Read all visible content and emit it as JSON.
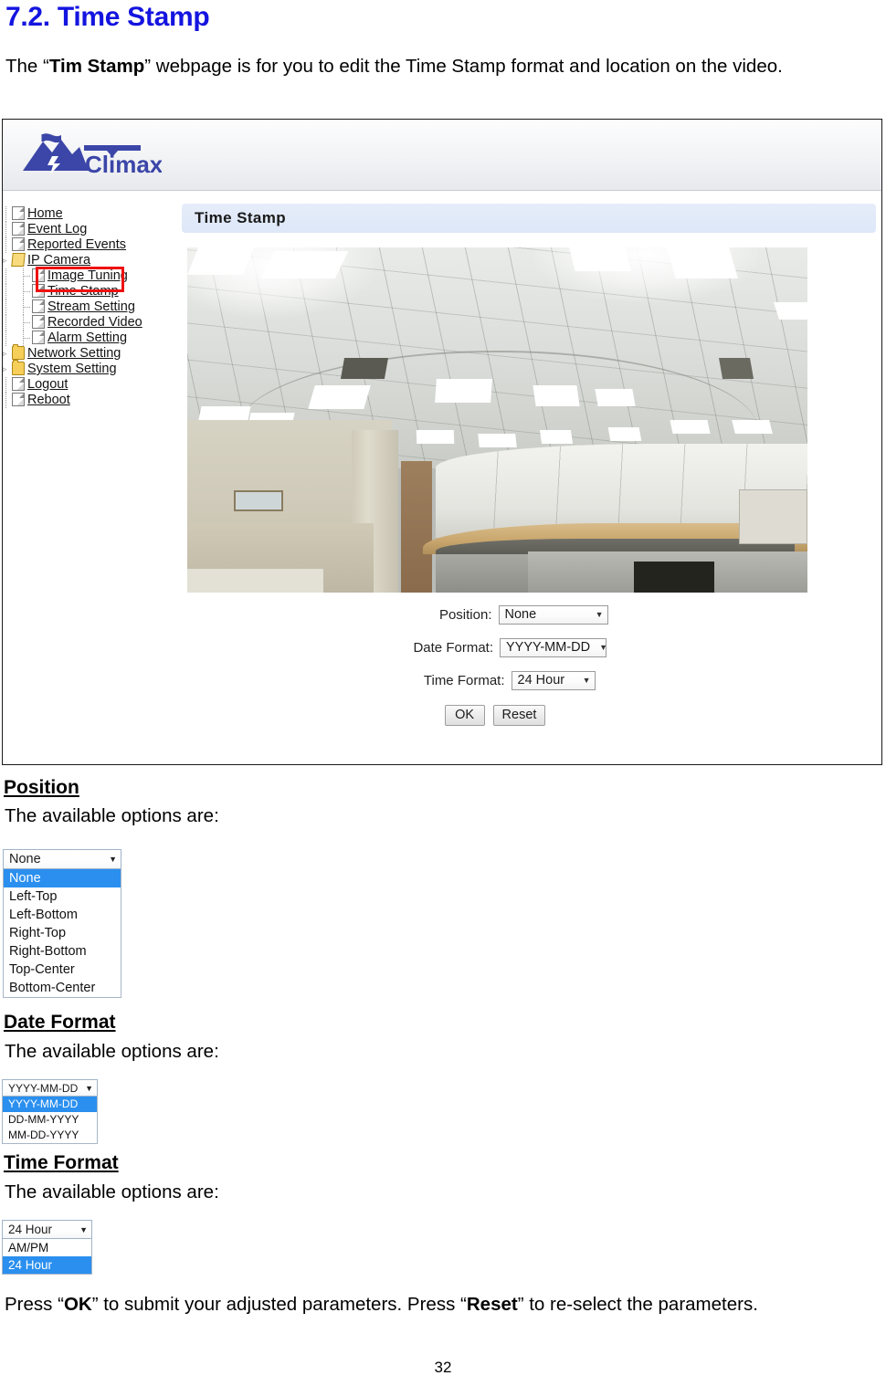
{
  "document": {
    "heading": "7.2. Time Stamp",
    "intro_prefix": "The “",
    "intro_bold": "Tim Stamp",
    "intro_suffix": "” webpage is for you to edit the Time Stamp format and location on the video.",
    "page_number": "32",
    "press_prefix": "Press “",
    "press_ok": "OK",
    "press_mid": "” to submit your adjusted parameters. Press “",
    "press_reset": "Reset",
    "press_suffix": "” to re-select the parameters."
  },
  "sections": [
    {
      "heading": "Position",
      "subtext": "The available options are:"
    },
    {
      "heading": "Date Format",
      "subtext": "The available options are:"
    },
    {
      "heading": "Time Format",
      "subtext": "The available options are:"
    }
  ],
  "webui": {
    "brand": "Climax",
    "panel_title": "Time Stamp",
    "sidebar": [
      {
        "label": "Home",
        "icon": "page-icon",
        "level": 0,
        "expander": ""
      },
      {
        "label": "Event Log",
        "icon": "page-icon",
        "level": 0,
        "expander": ""
      },
      {
        "label": "Reported Events",
        "icon": "page-icon",
        "level": 0,
        "expander": ""
      },
      {
        "label": "IP Camera",
        "icon": "folder-open-icon",
        "level": 0,
        "expander": "▹"
      },
      {
        "label": "Image Tuning",
        "icon": "page-icon",
        "level": 1,
        "expander": ""
      },
      {
        "label": "Time Stamp",
        "icon": "page-icon",
        "level": 1,
        "expander": ""
      },
      {
        "label": "Stream Setting",
        "icon": "page-icon",
        "level": 1,
        "expander": ""
      },
      {
        "label": "Recorded Video",
        "icon": "page-icon",
        "level": 1,
        "expander": ""
      },
      {
        "label": "Alarm Setting",
        "icon": "page-icon",
        "level": 1,
        "expander": ""
      },
      {
        "label": "Network Setting",
        "icon": "folder-icon",
        "level": 0,
        "expander": "▹"
      },
      {
        "label": "System Setting",
        "icon": "folder-icon",
        "level": 0,
        "expander": "▹"
      },
      {
        "label": "Logout",
        "icon": "page-icon",
        "level": 0,
        "expander": ""
      },
      {
        "label": "Reboot",
        "icon": "page-icon",
        "level": 0,
        "expander": ""
      }
    ],
    "form": {
      "position_label": "Position:",
      "position_value": "None",
      "date_format_label": "Date Format:",
      "date_format_value": "YYYY-MM-DD",
      "time_format_label": "Time Format:",
      "time_format_value": "24 Hour",
      "ok_label": "OK",
      "reset_label": "Reset",
      "caret": "▼"
    }
  },
  "dropdowns": {
    "position": {
      "selected": "None",
      "options": [
        "None",
        "Left-Top",
        "Left-Bottom",
        "Right-Top",
        "Right-Bottom",
        "Top-Center",
        "Bottom-Center"
      ],
      "highlighted_index": 0
    },
    "date_format": {
      "selected": "YYYY-MM-DD",
      "options": [
        "YYYY-MM-DD",
        "DD-MM-YYYY",
        "MM-DD-YYYY"
      ],
      "highlighted_index": 0
    },
    "time_format": {
      "selected": "24 Hour",
      "options": [
        "AM/PM",
        "24 Hour"
      ],
      "highlighted_index": 1
    }
  },
  "colors": {
    "heading": "#1414e0",
    "highlight_box": "#ee1111",
    "option_highlight": "#2a8fef",
    "panel_title_bg": "#e2ebf8",
    "brand": "#3b46a8"
  }
}
